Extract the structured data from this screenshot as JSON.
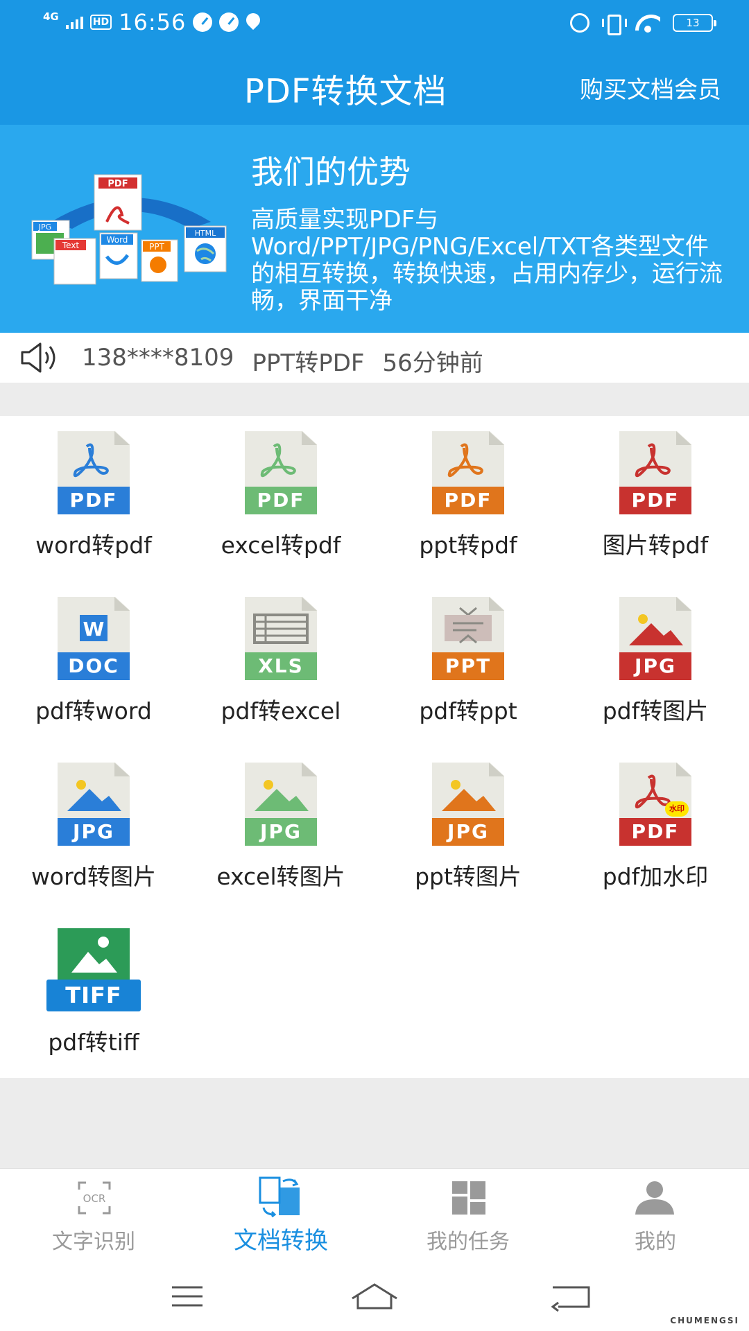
{
  "status_bar": {
    "network": "4G",
    "hd": "HD",
    "time": "16:56",
    "battery": "13"
  },
  "header": {
    "title": "PDF转换文档",
    "buy_label": "购买文档会员"
  },
  "banner": {
    "title": "我们的优势",
    "description": "高质量实现PDF与Word/PPT/JPG/PNG/Excel/TXT各类型文件的相互转换，转换快速，占用内存少，运行流畅，界面干净",
    "art_labels": [
      "PDF",
      "JPG",
      "Word",
      "Text",
      "PPT",
      "HTML"
    ]
  },
  "notice": {
    "phone": "138****8109",
    "action": "PPT转PDF",
    "time_ago": "56分钟前"
  },
  "tools": [
    {
      "label": "word转pdf",
      "band": "PDF",
      "color": "#2a7ed8",
      "icon": "pdf-icon"
    },
    {
      "label": "excel转pdf",
      "band": "PDF",
      "color": "#6dbb75",
      "icon": "pdf-icon"
    },
    {
      "label": "ppt转pdf",
      "band": "PDF",
      "color": "#e0751c",
      "icon": "pdf-icon"
    },
    {
      "label": "图片转pdf",
      "band": "PDF",
      "color": "#c8322f",
      "icon": "pdf-icon"
    },
    {
      "label": "pdf转word",
      "band": "DOC",
      "color": "#2a7ed8",
      "icon": "word-doc-icon"
    },
    {
      "label": "pdf转excel",
      "band": "XLS",
      "color": "#6dbb75",
      "icon": "excel-xls-icon"
    },
    {
      "label": "pdf转ppt",
      "band": "PPT",
      "color": "#e0751c",
      "icon": "ppt-icon"
    },
    {
      "label": "pdf转图片",
      "band": "JPG",
      "color": "#c8322f",
      "icon": "jpg-image-icon"
    },
    {
      "label": "word转图片",
      "band": "JPG",
      "color": "#2a7ed8",
      "icon": "jpg-image-icon"
    },
    {
      "label": "excel转图片",
      "band": "JPG",
      "color": "#6dbb75",
      "icon": "jpg-image-icon"
    },
    {
      "label": "ppt转图片",
      "band": "JPG",
      "color": "#e0751c",
      "icon": "jpg-image-icon"
    },
    {
      "label": "pdf加水印",
      "band": "PDF",
      "color": "#c8322f",
      "icon": "pdf-watermark-icon",
      "badge": "水印"
    },
    {
      "label": "pdf转tiff",
      "band": "TIFF",
      "color": "#1883d6",
      "icon": "tiff-image-icon"
    }
  ],
  "bottom_nav": [
    {
      "label": "文字识别",
      "icon": "ocr-icon",
      "icon_text": "OCR",
      "active": false
    },
    {
      "label": "文档转换",
      "icon": "document-convert-icon",
      "active": true
    },
    {
      "label": "我的任务",
      "icon": "grid-tasks-icon",
      "active": false
    },
    {
      "label": "我的",
      "icon": "user-icon",
      "active": false
    }
  ],
  "watermark": "CHUMENGSI",
  "colors": {
    "primary": "#1a97e4",
    "banner": "#2aa8ee",
    "active_nav": "#1a8fe0",
    "inactive_nav": "#9a9a9a"
  }
}
